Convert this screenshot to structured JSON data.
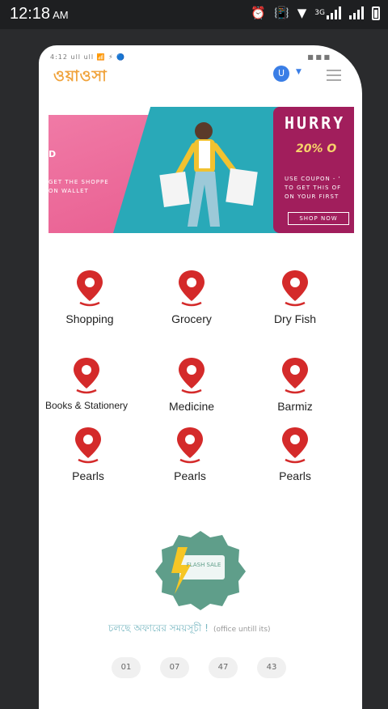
{
  "status_bar": {
    "time": "12:18",
    "ampm": "AM",
    "network": "3G",
    "icons": [
      "alarm-icon",
      "vibrate-icon",
      "wifi-icon",
      "signal-icon",
      "battery-icon"
    ]
  },
  "inner_status": {
    "left": "4:12 ull ull 📶 ⚡ 🔵",
    "right": "■ ■ ■"
  },
  "header": {
    "logo": "ওয়াওসা",
    "user_initial": "U"
  },
  "banner": {
    "left_line1": "D",
    "left_line2": "GET THE SHOPPE\nON WALLET",
    "hurry": "HURRY",
    "discount": "20% O",
    "coupon": "USE COUPON - '\nTO GET THIS OF\nON YOUR FIRST",
    "shop_now": "SHOP NOW"
  },
  "categories": [
    {
      "label": "Shopping"
    },
    {
      "label": "Grocery"
    },
    {
      "label": "Dry Fish"
    },
    {
      "label": "Books & Stationery"
    },
    {
      "label": "Medicine"
    },
    {
      "label": "Barmiz"
    },
    {
      "label": "Pearls"
    },
    {
      "label": "Pearls"
    },
    {
      "label": "Pearls"
    }
  ],
  "flash": {
    "badge_text": "FLASH SALE",
    "bengali_text": "চলছে অফারের সময়সূচী !",
    "bengali_sub": "(office untill its)",
    "timer": [
      "01",
      "07",
      "47",
      "43"
    ]
  },
  "colors": {
    "pin_red": "#d42a2a",
    "banner_pink": "#e96092",
    "banner_teal": "#29a9b8",
    "banner_magenta": "#a11e5c",
    "badge_green": "#5f9e8a",
    "bolt_yellow": "#f6c624"
  }
}
